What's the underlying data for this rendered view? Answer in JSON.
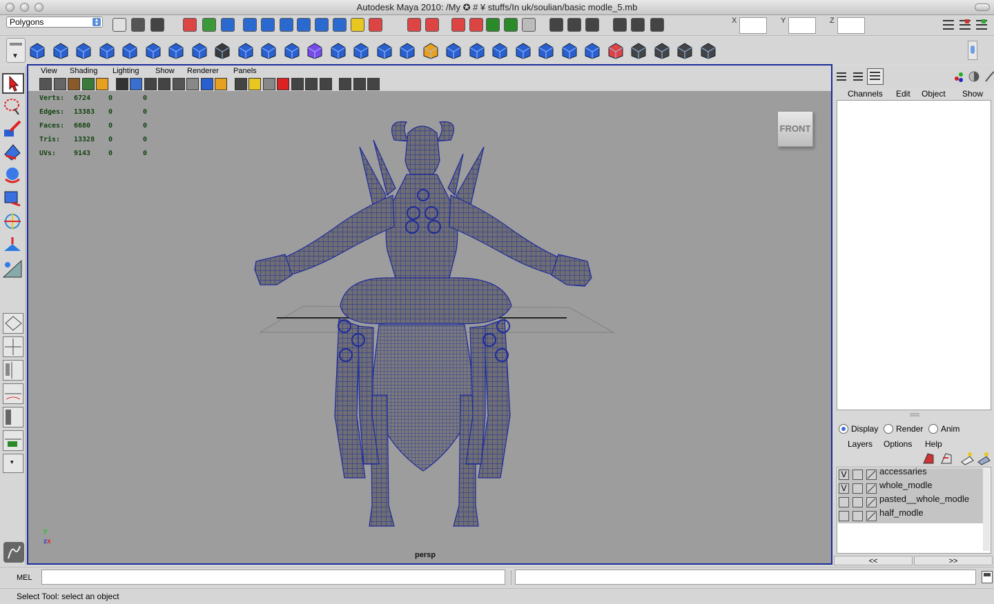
{
  "window": {
    "title": "Autodesk Maya 2010: /My ✪ # ¥ stuffs/In uk/soulian/basic modle_5.mb"
  },
  "status_line": {
    "menu_set": "Polygons",
    "x_label": "X",
    "y_label": "Y",
    "z_label": "Z",
    "x_value": "",
    "y_value": "",
    "z_value": ""
  },
  "panel": {
    "menus": [
      "View",
      "Shading",
      "Lighting",
      "Show",
      "Renderer",
      "Panels"
    ],
    "camera": "persp",
    "viewcube_label": "FRONT"
  },
  "hud": {
    "rows": [
      {
        "label": "Verts:",
        "v1": "6724",
        "v2": "0",
        "v3": "0"
      },
      {
        "label": "Edges:",
        "v1": "13383",
        "v2": "0",
        "v3": "0"
      },
      {
        "label": "Faces:",
        "v1": "6680",
        "v2": "0",
        "v3": "0"
      },
      {
        "label": "Tris:",
        "v1": "13328",
        "v2": "0",
        "v3": "0"
      },
      {
        "label": "UVs:",
        "v1": "9143",
        "v2": "0",
        "v3": "0"
      }
    ]
  },
  "axis": {
    "y": "y",
    "z": "z",
    "x": "x"
  },
  "channel_box": {
    "menus": [
      "Channels",
      "Edit",
      "Object",
      "Show"
    ]
  },
  "layer_editor": {
    "modes": [
      {
        "label": "Display",
        "selected": true
      },
      {
        "label": "Render",
        "selected": false
      },
      {
        "label": "Anim",
        "selected": false
      }
    ],
    "menus": [
      "Layers",
      "Options",
      "Help"
    ],
    "layers": [
      {
        "visible": "V",
        "template": "",
        "name": "accessaries"
      },
      {
        "visible": "V",
        "template": "",
        "name": "whole_modle"
      },
      {
        "visible": "",
        "template": "",
        "name": "pasted__whole_modle"
      },
      {
        "visible": "",
        "template": "",
        "name": "half_modle"
      }
    ],
    "prev_page": "<<",
    "next_page": ">>"
  },
  "command_line": {
    "language": "MEL",
    "input": "",
    "output": ""
  },
  "help_line": {
    "text": "Select Tool: select an object"
  },
  "colors": {
    "panel_border": "#1a2c9a",
    "viewport_bg": "#9d9d9d",
    "wire": "#1e2a9a"
  }
}
